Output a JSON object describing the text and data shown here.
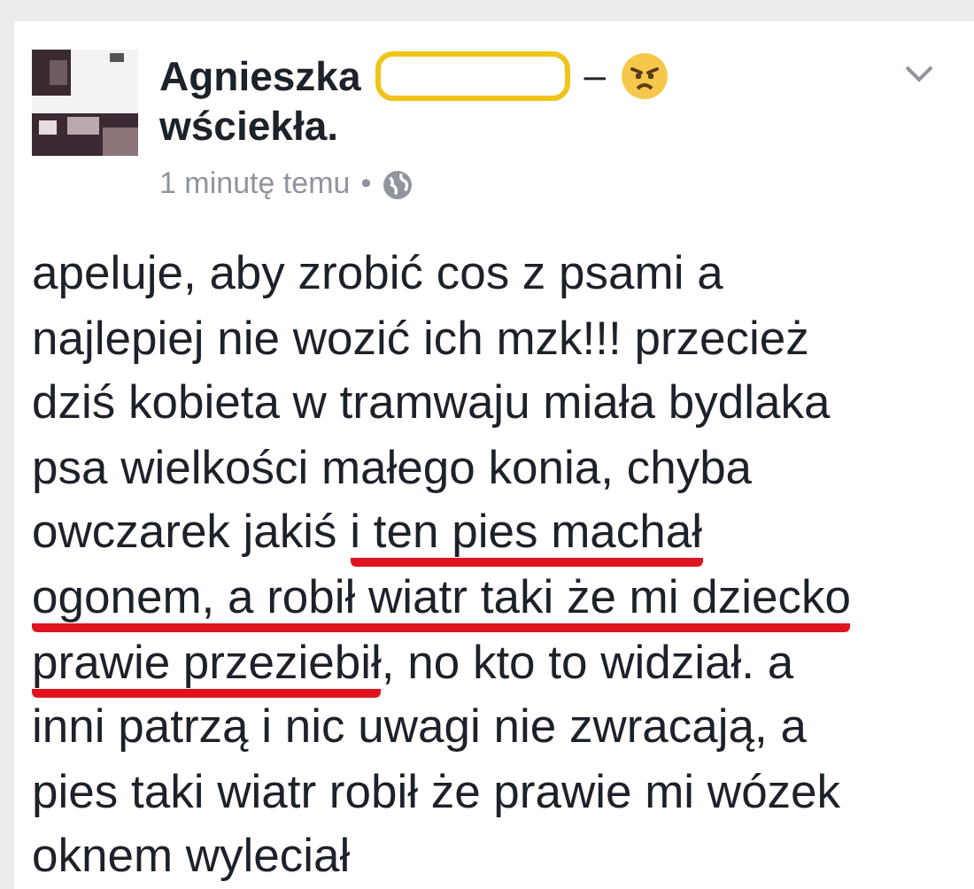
{
  "post": {
    "author": "Agnieszka",
    "feeling_dash": "–",
    "feeling": "wściekła.",
    "time": "1 minutę temu",
    "dot": "•",
    "body_lines": [
      {
        "segments": [
          {
            "text": "apeluje, aby zrobić cos z psami a",
            "underlined": false
          }
        ]
      },
      {
        "segments": [
          {
            "text": "najlepiej nie wozić ich mzk!!! przecież",
            "underlined": false
          }
        ]
      },
      {
        "segments": [
          {
            "text": "dziś kobieta w tramwaju miała bydlaka",
            "underlined": false
          }
        ]
      },
      {
        "segments": [
          {
            "text": "psa wielkości małego konia, chyba",
            "underlined": false
          }
        ]
      },
      {
        "segments": [
          {
            "text": "owczarek jakiś ",
            "underlined": false
          },
          {
            "text": "i ten pies machał",
            "underlined": true
          }
        ]
      },
      {
        "segments": [
          {
            "text": "ogonem, a robił wiatr taki że mi dziecko",
            "underlined": true
          }
        ]
      },
      {
        "segments": [
          {
            "text": "prawie przeziebił",
            "underlined": true
          },
          {
            "text": ", no kto to widział. a",
            "underlined": false
          }
        ]
      },
      {
        "segments": [
          {
            "text": "inni patrzą i nic uwagi nie zwracają, a",
            "underlined": false
          }
        ]
      },
      {
        "segments": [
          {
            "text": "pies taki wiatr robił że prawie mi wózek",
            "underlined": false
          }
        ]
      },
      {
        "segments": [
          {
            "text": "oknem wyleciał",
            "underlined": false
          }
        ]
      }
    ]
  }
}
